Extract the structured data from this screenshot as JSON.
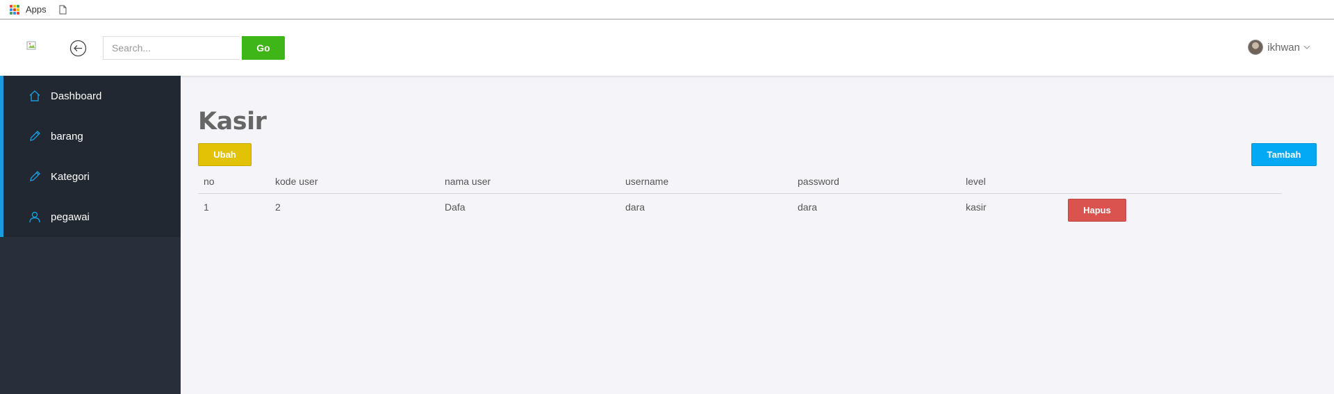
{
  "bookmarks": {
    "apps_label": "Apps"
  },
  "header": {
    "search_placeholder": "Search...",
    "go_label": "Go",
    "username": "ikhwan",
    "colors": {
      "go": "#3fb618"
    }
  },
  "sidebar": {
    "items": [
      {
        "label": "Dashboard",
        "icon": "home-icon"
      },
      {
        "label": "barang",
        "icon": "pencil-icon"
      },
      {
        "label": "Kategori",
        "icon": "pencil-icon"
      },
      {
        "label": "pegawai",
        "icon": "user-icon"
      }
    ],
    "accent": "#1a9bdf"
  },
  "main": {
    "title": "Kasir",
    "ubah_label": "Ubah",
    "tambah_label": "Tambah",
    "hapus_label": "Hapus",
    "table": {
      "headers": [
        "no",
        "kode user",
        "nama user",
        "username",
        "password",
        "level"
      ],
      "rows": [
        [
          "1",
          "2",
          "Dafa",
          "dara",
          "dara",
          "kasir"
        ]
      ]
    },
    "colors": {
      "ubah": "#e2c205",
      "tambah": "#03a9f4",
      "hapus": "#d9534f"
    }
  }
}
